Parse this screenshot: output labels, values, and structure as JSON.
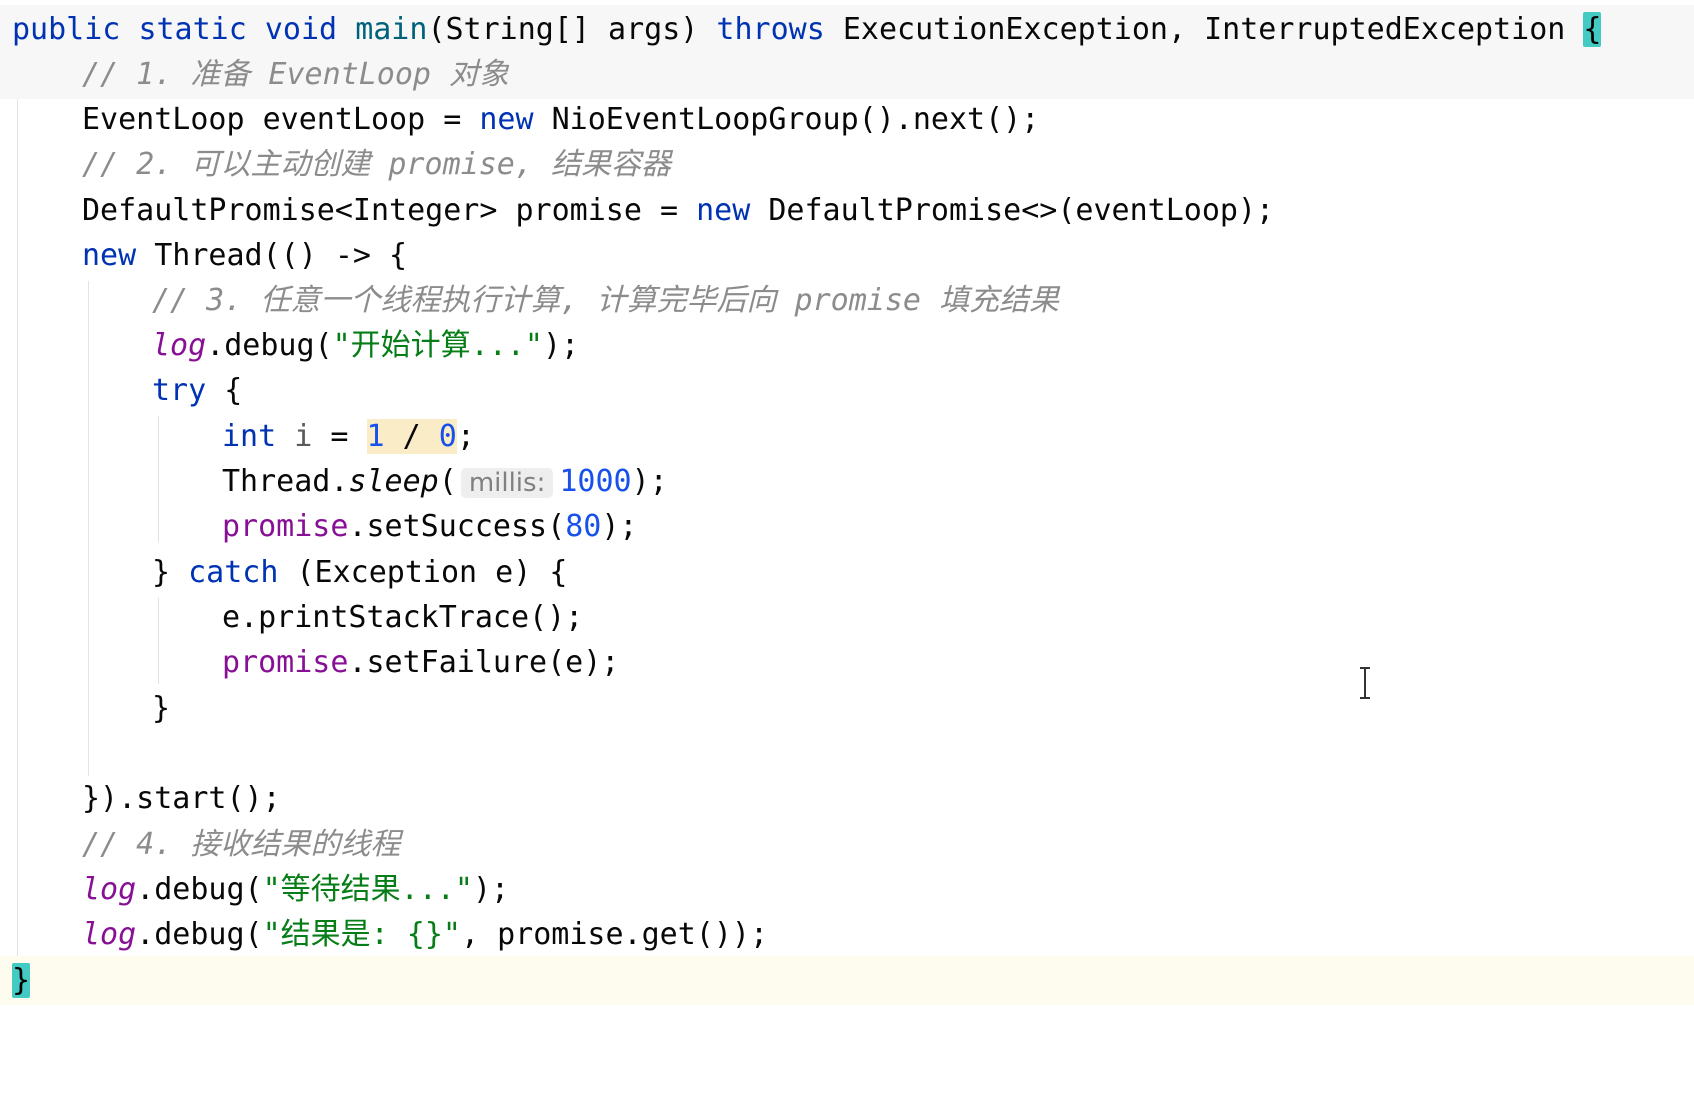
{
  "code": {
    "l1": {
      "public": "public",
      "static": "static",
      "void": "void",
      "main": "main",
      "params": "(String[] args) ",
      "throws": "throws",
      "exceptions": " ExecutionException, InterruptedException ",
      "brace": "{"
    },
    "l2": {
      "comment": "// 1. 准备 EventLoop 对象"
    },
    "l3": {
      "pre": "EventLoop eventLoop = ",
      "new": "new",
      "post": " NioEventLoopGroup().next();"
    },
    "l4": {
      "comment": "// 2. 可以主动创建 promise, 结果容器"
    },
    "l5": {
      "pre": "DefaultPromise<Integer> promise = ",
      "new": "new",
      "post": " DefaultPromise<>(eventLoop);"
    },
    "l6": {
      "new": "new",
      "post": " Thread(() -> {"
    },
    "l7": {
      "comment": "// 3. 任意一个线程执行计算, 计算完毕后向 promise 填充结果"
    },
    "l8": {
      "log": "log",
      "call": ".debug(",
      "str": "\"开始计算...\"",
      "end": ");"
    },
    "l9": {
      "try": "try",
      "brace": " {"
    },
    "l10": {
      "int": "int",
      "var": " i",
      "eq": " = ",
      "one": "1",
      "div": " / ",
      "zero": "0",
      "end": ";"
    },
    "l11": {
      "pre": "Thread.",
      "sleep": "sleep",
      "open": "(",
      "hint": "millis:",
      "num": "1000",
      "end": ");"
    },
    "l12": {
      "promise": "promise",
      "call": ".setSuccess(",
      "num": "80",
      "end": ");"
    },
    "l13": {
      "close": "} ",
      "catch": "catch",
      "post": " (Exception e) {"
    },
    "l14": {
      "text": "e.printStackTrace();"
    },
    "l15": {
      "promise": "promise",
      "call": ".setFailure(e);"
    },
    "l16": {
      "text": "}"
    },
    "l18": {
      "text": "}).start();"
    },
    "l19": {
      "comment": "// 4. 接收结果的线程"
    },
    "l20": {
      "log": "log",
      "call": ".debug(",
      "str": "\"等待结果...\"",
      "end": ");"
    },
    "l21": {
      "log": "log",
      "call": ".debug(",
      "str": "\"结果是: {}\"",
      "post": ", promise.get());"
    },
    "l22": {
      "brace": "}"
    }
  },
  "colors": {
    "keyword": "#0033b3",
    "method_decl": "#00627a",
    "comment": "#8c8c8c",
    "string": "#067d17",
    "number": "#1750eb",
    "field": "#871094",
    "brace_match": "#43cbc3",
    "selection": "#f9ecc6"
  },
  "icons": {
    "cursor": "text-cursor-icon"
  }
}
